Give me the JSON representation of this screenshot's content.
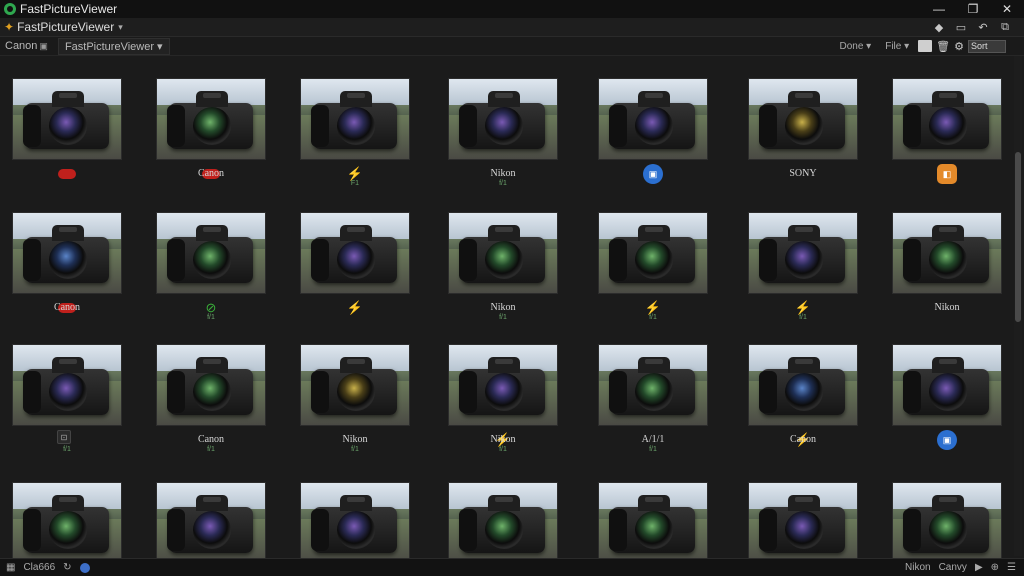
{
  "titlebar": {
    "app_name": "FastPictureViewer",
    "controls": [
      "—",
      "❐",
      "✕"
    ]
  },
  "toolbar1": {
    "title": "FastPictureViewer",
    "icons": [
      "diamond-icon",
      "window-icon",
      "undo-icon",
      "external-link-icon"
    ]
  },
  "toolbar2": {
    "breadcrumb": "Canon",
    "dropdown": "FastPictureViewer",
    "right": {
      "done_dropdown": "Done",
      "file_dropdown": "File",
      "search_value": "Sort"
    }
  },
  "grid": {
    "tiles": [
      {
        "label": "",
        "badge": "red",
        "lens": "",
        "sub": ""
      },
      {
        "label": "Canon",
        "badge": "red",
        "lens": "g",
        "sub": ""
      },
      {
        "label": "",
        "badge": "yellow",
        "lens": "",
        "sub": "F1"
      },
      {
        "label": "Nikon",
        "badge": "",
        "lens": "",
        "sub": "f/1"
      },
      {
        "label": "",
        "badge": "blue",
        "lens": "",
        "sub": ""
      },
      {
        "label": "SONY",
        "badge": "",
        "lens": "y",
        "sub": ""
      },
      {
        "label": "",
        "badge": "orange",
        "lens": "",
        "sub": ""
      },
      {
        "label": "Canon",
        "badge": "red",
        "lens": "b",
        "sub": ""
      },
      {
        "label": "",
        "badge": "green",
        "lens": "g",
        "sub": "f/1"
      },
      {
        "label": "",
        "badge": "yellow",
        "lens": "",
        "sub": ""
      },
      {
        "label": "Nikon",
        "badge": "",
        "lens": "g",
        "sub": "f/1"
      },
      {
        "label": "",
        "badge": "yellow",
        "lens": "g",
        "sub": "f/1"
      },
      {
        "label": "",
        "badge": "yellow",
        "lens": "",
        "sub": "f/1"
      },
      {
        "label": "Nikon",
        "badge": "",
        "lens": "g",
        "sub": ""
      },
      {
        "label": "",
        "badge": "square",
        "lens": "",
        "sub": "f/1"
      },
      {
        "label": "Canon",
        "badge": "",
        "lens": "g",
        "sub": "f/1"
      },
      {
        "label": "Nikon",
        "badge": "",
        "lens": "y",
        "sub": "f/1"
      },
      {
        "label": "Nikon",
        "badge": "yellow",
        "lens": "",
        "sub": "f/1"
      },
      {
        "label": "A/1/1",
        "badge": "",
        "lens": "g",
        "sub": "f/1"
      },
      {
        "label": "Canon",
        "badge": "yellow",
        "lens": "b",
        "sub": ""
      },
      {
        "label": "",
        "badge": "blue",
        "lens": "",
        "sub": ""
      },
      {
        "label": "",
        "badge": "",
        "lens": "g",
        "sub": ""
      },
      {
        "label": "",
        "badge": "",
        "lens": "",
        "sub": ""
      },
      {
        "label": "",
        "badge": "",
        "lens": "",
        "sub": ""
      },
      {
        "label": "",
        "badge": "",
        "lens": "g",
        "sub": ""
      },
      {
        "label": "",
        "badge": "",
        "lens": "g",
        "sub": ""
      },
      {
        "label": "",
        "badge": "",
        "lens": "",
        "sub": ""
      },
      {
        "label": "",
        "badge": "",
        "lens": "g",
        "sub": ""
      }
    ]
  },
  "statusbar": {
    "left_text": "Cla666",
    "right_text_1": "Nikon",
    "right_text_2": "Canvy"
  },
  "colors": {
    "background": "#1b1b1b",
    "accent_green": "#2fa84f",
    "badge_red": "#c0201c",
    "badge_blue": "#2b6fd0",
    "badge_orange": "#e48a2a"
  }
}
